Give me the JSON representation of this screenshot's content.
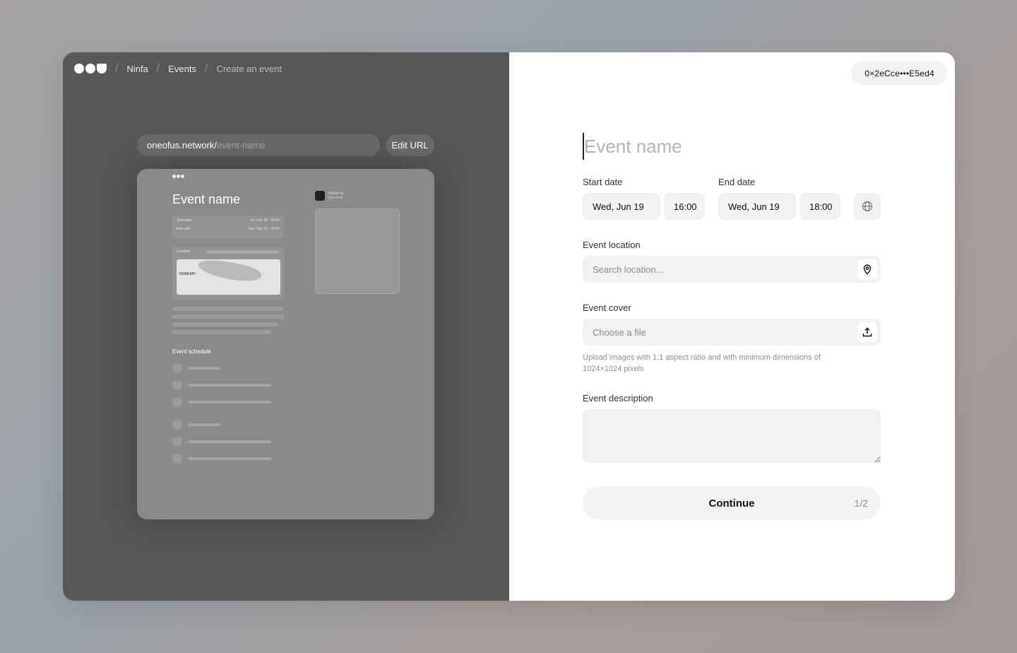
{
  "breadcrumb": {
    "items": [
      "Ninfa",
      "Events",
      "Create an event"
    ]
  },
  "url": {
    "host": "oneofus.network/",
    "slug": "event-name",
    "edit_label": "Edit URL"
  },
  "preview": {
    "title": "Event name",
    "start_label": "Start date",
    "start_value": "Fri, Sep 30 · 16:00",
    "end_label": "End date",
    "end_value": "Sun, Sep 22 · 16:00",
    "location_label": "Location",
    "map_label": "YENIKAPI",
    "schedule_title": "Event schedule",
    "hosted_label": "Hosted by",
    "hosted_name": "One of us"
  },
  "wallet": {
    "address": "0×2eCce•••E5ed4"
  },
  "form": {
    "name_placeholder": "Event name",
    "start_label": "Start date",
    "start_date": "Wed, Jun 19",
    "start_time": "16:00",
    "end_label": "End date",
    "end_date": "Wed, Jun 19",
    "end_time": "18:00",
    "location_label": "Event location",
    "location_placeholder": "Search location...",
    "cover_label": "Event cover",
    "cover_placeholder": "Choose a file",
    "cover_hint": "Upload images with 1:1 aspect ratio and with minimum dimensions of 1024×1024 pixels",
    "description_label": "Event description",
    "continue_label": "Continue",
    "step": "1/2"
  },
  "icons": {
    "logo": "logo-icon",
    "timezone": "globe-icon",
    "location": "map-pin-icon",
    "upload": "upload-icon"
  }
}
